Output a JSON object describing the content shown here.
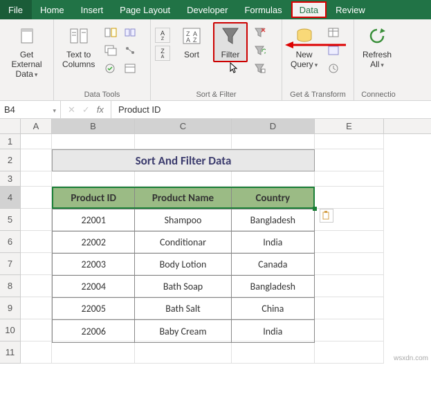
{
  "tabs": {
    "file": "File",
    "home": "Home",
    "insert": "Insert",
    "page_layout": "Page Layout",
    "developer": "Developer",
    "formulas": "Formulas",
    "data": "Data",
    "review": "Review"
  },
  "ribbon": {
    "get_external": "Get External\nData",
    "text_to_columns": "Text to\nColumns",
    "data_tools": "Data Tools",
    "sort": "Sort",
    "filter": "Filter",
    "sort_filter": "Sort & Filter",
    "new_query": "New\nQuery",
    "get_transform": "Get & Transform",
    "refresh_all": "Refresh\nAll",
    "connections": "Connectio"
  },
  "namebox": "B4",
  "formula_fx": "fx",
  "formula_value": "Product ID",
  "columns": [
    "A",
    "B",
    "C",
    "D",
    "E"
  ],
  "rows": [
    "1",
    "2",
    "3",
    "4",
    "5",
    "6",
    "7",
    "8",
    "9",
    "10",
    "11"
  ],
  "title": "Sort And Filter Data",
  "table": {
    "headers": [
      "Product ID",
      "Product Name",
      "Country"
    ],
    "rows": [
      [
        "22001",
        "Shampoo",
        "Bangladesh"
      ],
      [
        "22002",
        "Conditionar",
        "India"
      ],
      [
        "22003",
        "Body Lotion",
        "Canada"
      ],
      [
        "22004",
        "Bath Soap",
        "Bangladesh"
      ],
      [
        "22005",
        "Bath Salt",
        "China"
      ],
      [
        "22006",
        "Baby Cream",
        "India"
      ]
    ]
  },
  "watermark": "wsxdn.com"
}
